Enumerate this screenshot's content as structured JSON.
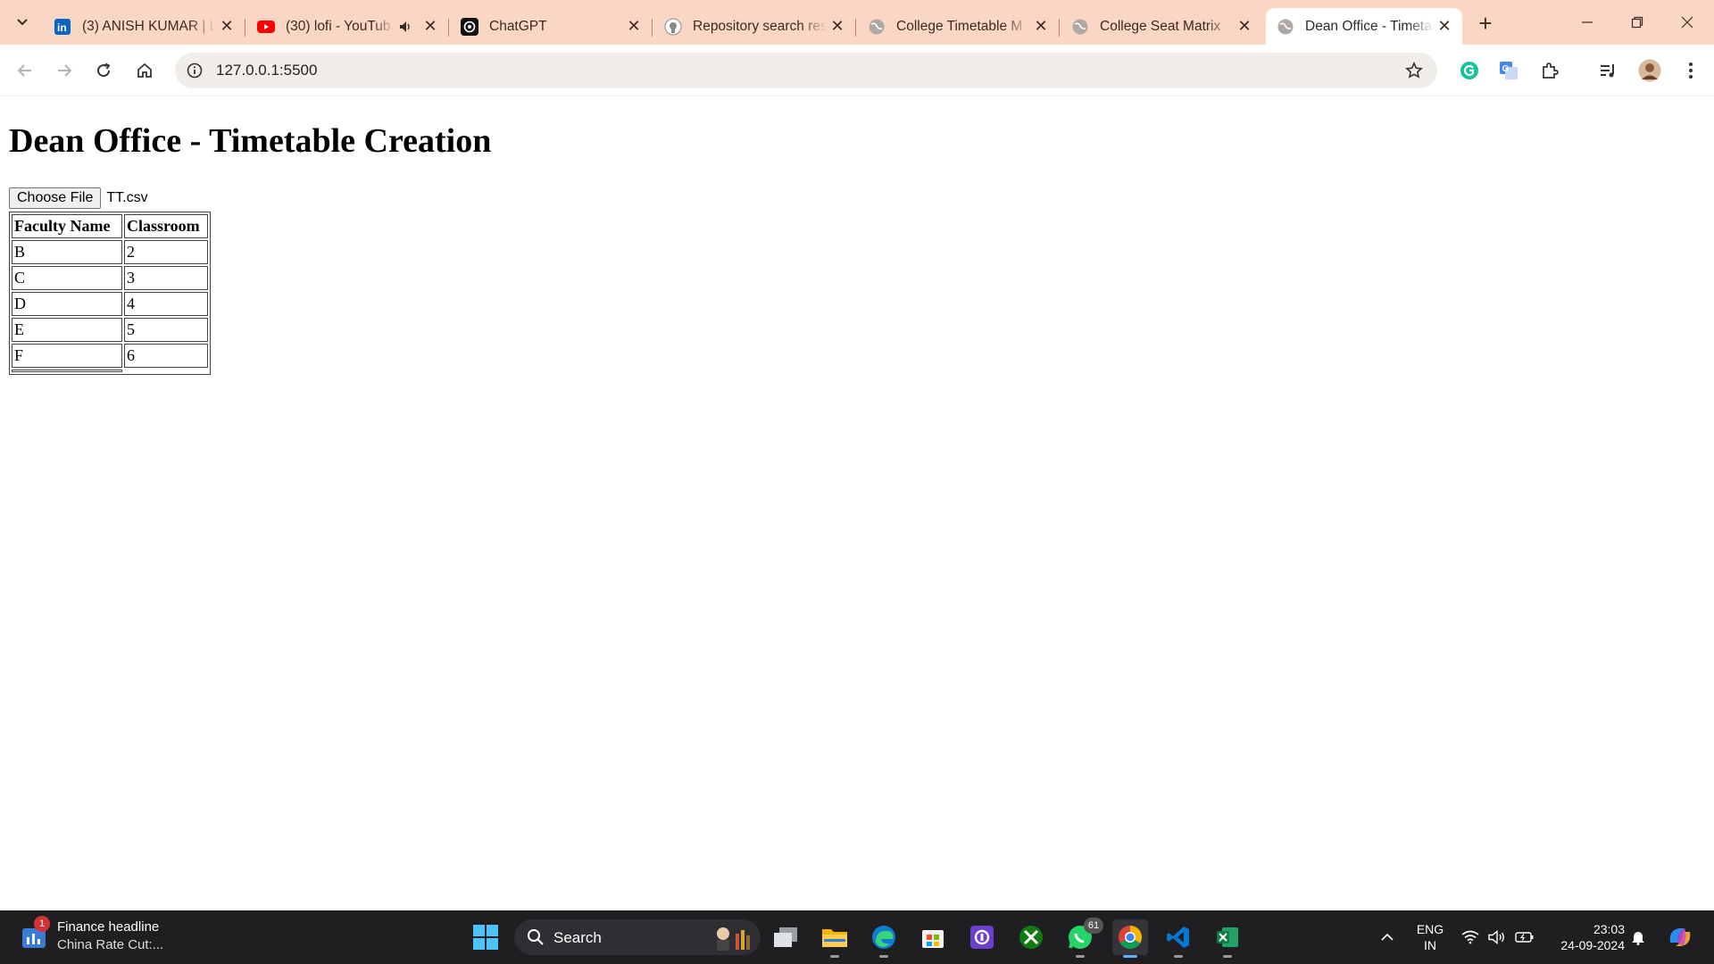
{
  "browser": {
    "tabs": [
      {
        "title": "(3) ANISH KUMAR | L",
        "favicon": "linkedin-icon",
        "active": false
      },
      {
        "title": "(30) lofi - YouTub",
        "favicon": "youtube-icon",
        "active": false,
        "audio": true
      },
      {
        "title": "ChatGPT",
        "favicon": "chatgpt-icon",
        "active": false
      },
      {
        "title": "Repository search res",
        "favicon": "github-icon",
        "active": false
      },
      {
        "title": "College Timetable M",
        "favicon": "globe-icon",
        "active": false
      },
      {
        "title": "College Seat Matrix",
        "favicon": "globe-icon",
        "active": false
      },
      {
        "title": "Dean Office - Timeta",
        "favicon": "globe-icon",
        "active": true
      }
    ],
    "address": "127.0.0.1:5500"
  },
  "page": {
    "heading": "Dean Office - Timetable Creation",
    "file_button": "Choose File",
    "file_name": "TT.csv",
    "table": {
      "headers": [
        "Faculty Name",
        "Classroom"
      ],
      "rows": [
        [
          "B",
          "2"
        ],
        [
          "C",
          "3"
        ],
        [
          "D",
          "4"
        ],
        [
          "E",
          "5"
        ],
        [
          "F",
          "6"
        ]
      ]
    }
  },
  "taskbar": {
    "news_title": "Finance headline",
    "news_subtitle": "China Rate Cut:...",
    "news_badge": "1",
    "search_label": "Search",
    "whatsapp_badge": "61",
    "lang_line1": "ENG",
    "lang_line2": "IN",
    "time": "23:03",
    "date": "24-09-2024"
  },
  "colors": {
    "tab_strip": "#fad6c4",
    "taskbar": "#1f1f22",
    "accent": "#5eb0ef"
  }
}
